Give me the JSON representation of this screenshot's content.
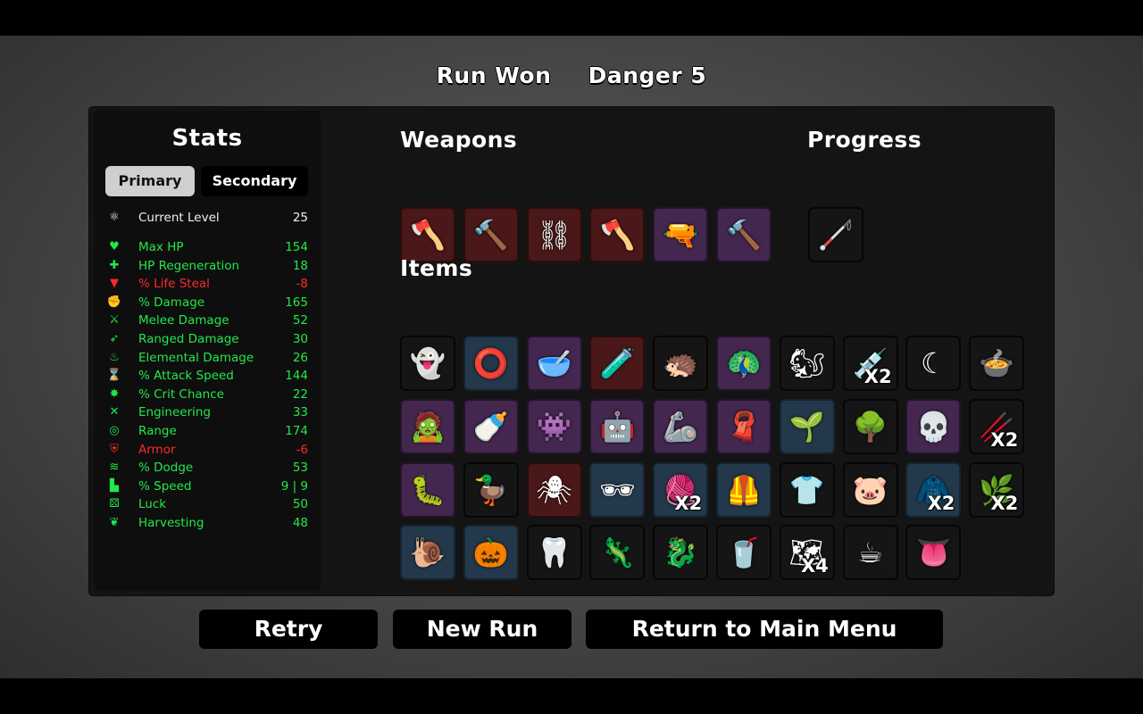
{
  "header": {
    "result": "Run Won",
    "danger": "Danger 5"
  },
  "stats": {
    "title": "Stats",
    "tabs": {
      "primary": "Primary",
      "secondary": "Secondary"
    },
    "level": {
      "label": "Current Level",
      "value": "25",
      "icon": "level-icon"
    },
    "rows": [
      {
        "label": "Max HP",
        "value": "154",
        "color": "#22e84a",
        "icon": "heart-icon"
      },
      {
        "label": "HP Regeneration",
        "value": "18",
        "color": "#22e84a",
        "icon": "heart-plus-icon"
      },
      {
        "label": "% Life Steal",
        "value": "-8",
        "color": "#ff2a2a",
        "icon": "fangs-icon"
      },
      {
        "label": "% Damage",
        "value": "165",
        "color": "#22e84a",
        "icon": "fist-icon"
      },
      {
        "label": "Melee Damage",
        "value": "52",
        "color": "#22e84a",
        "icon": "sword-icon"
      },
      {
        "label": "Ranged Damage",
        "value": "30",
        "color": "#22e84a",
        "icon": "bow-icon"
      },
      {
        "label": "Elemental Damage",
        "value": "26",
        "color": "#22e84a",
        "icon": "flame-icon"
      },
      {
        "label": "% Attack Speed",
        "value": "144",
        "color": "#22e84a",
        "icon": "hourglass-icon"
      },
      {
        "label": "% Crit Chance",
        "value": "22",
        "color": "#22e84a",
        "icon": "crit-icon"
      },
      {
        "label": "Engineering",
        "value": "33",
        "color": "#22e84a",
        "icon": "wrench-icon"
      },
      {
        "label": "Range",
        "value": "174",
        "color": "#22e84a",
        "icon": "range-icon"
      },
      {
        "label": "Armor",
        "value": "-6",
        "color": "#ff2a2a",
        "icon": "shield-icon"
      },
      {
        "label": "% Dodge",
        "value": "53",
        "color": "#22e84a",
        "icon": "dodge-icon"
      },
      {
        "label": "% Speed",
        "value": "9 | 9",
        "color": "#22e84a",
        "icon": "boot-icon"
      },
      {
        "label": "Luck",
        "value": "50",
        "color": "#22e84a",
        "icon": "dice-icon"
      },
      {
        "label": "Harvesting",
        "value": "48",
        "color": "#22e84a",
        "icon": "wheat-icon"
      }
    ]
  },
  "weapons": {
    "title": "Weapons",
    "slots": [
      {
        "icon": "axe-icon",
        "tier": "red"
      },
      {
        "icon": "skull-hammer-icon",
        "tier": "red"
      },
      {
        "icon": "chain-whip-icon",
        "tier": "red"
      },
      {
        "icon": "axe-icon",
        "tier": "red"
      },
      {
        "icon": "blaster-icon",
        "tier": "purple"
      },
      {
        "icon": "skull-hammer-icon",
        "tier": "purple"
      }
    ]
  },
  "progress": {
    "title": "Progress",
    "slots": [
      {
        "icon": "stick-icon",
        "tier": "black"
      }
    ]
  },
  "items": {
    "title": "Items",
    "slots": [
      {
        "icon": "ghost-icon",
        "tier": "black",
        "qty": ""
      },
      {
        "icon": "ring-icon",
        "tier": "blue",
        "qty": ""
      },
      {
        "icon": "mortar-icon",
        "tier": "purple",
        "qty": ""
      },
      {
        "icon": "test-tube-icon",
        "tier": "red",
        "qty": ""
      },
      {
        "icon": "hedgehog-icon",
        "tier": "black",
        "qty": ""
      },
      {
        "icon": "peacock-icon",
        "tier": "purple",
        "qty": ""
      },
      {
        "icon": "creature-icon",
        "tier": "black",
        "qty": ""
      },
      {
        "icon": "syringe-icon",
        "tier": "black",
        "qty": "X2"
      },
      {
        "icon": "sickle-icon",
        "tier": "black",
        "qty": ""
      },
      {
        "icon": "cauldron-icon",
        "tier": "black",
        "qty": ""
      },
      {
        "icon": "zombie-icon",
        "tier": "purple",
        "qty": ""
      },
      {
        "icon": "bottle-icon",
        "tier": "purple",
        "qty": ""
      },
      {
        "icon": "alien-icon",
        "tier": "purple",
        "qty": ""
      },
      {
        "icon": "robot-icon",
        "tier": "purple",
        "qty": ""
      },
      {
        "icon": "arm-icon",
        "tier": "purple",
        "qty": ""
      },
      {
        "icon": "bandana-icon",
        "tier": "purple",
        "qty": ""
      },
      {
        "icon": "garden-icon",
        "tier": "blue",
        "qty": ""
      },
      {
        "icon": "tree-icon",
        "tier": "black",
        "qty": ""
      },
      {
        "icon": "skull-pile-icon",
        "tier": "purple",
        "qty": ""
      },
      {
        "icon": "red-twig-icon",
        "tier": "black",
        "qty": "X2"
      },
      {
        "icon": "tardigrade-icon",
        "tier": "purple",
        "qty": ""
      },
      {
        "icon": "duck-icon",
        "tier": "black",
        "qty": ""
      },
      {
        "icon": "spider-icon",
        "tier": "red",
        "qty": ""
      },
      {
        "icon": "glasses-icon",
        "tier": "blue",
        "qty": ""
      },
      {
        "icon": "scarf-icon",
        "tier": "blue",
        "qty": "X2"
      },
      {
        "icon": "leather-vest-icon",
        "tier": "blue",
        "qty": ""
      },
      {
        "icon": "flannel-shirt-icon",
        "tier": "black",
        "qty": ""
      },
      {
        "icon": "piggy-bank-icon",
        "tier": "black",
        "qty": ""
      },
      {
        "icon": "cape-icon",
        "tier": "blue",
        "qty": "X2"
      },
      {
        "icon": "sprout-icon",
        "tier": "black",
        "qty": "X2"
      },
      {
        "icon": "snail-icon",
        "tier": "blue",
        "qty": ""
      },
      {
        "icon": "pumpkin-icon",
        "tier": "blue",
        "qty": ""
      },
      {
        "icon": "tooth-icon",
        "tier": "black",
        "qty": ""
      },
      {
        "icon": "lizard-icon",
        "tier": "black",
        "qty": ""
      },
      {
        "icon": "seahorse-icon",
        "tier": "black",
        "qty": ""
      },
      {
        "icon": "lemonade-icon",
        "tier": "black",
        "qty": ""
      },
      {
        "icon": "treasure-map-icon",
        "tier": "black",
        "qty": "X4"
      },
      {
        "icon": "coffee-cup-icon",
        "tier": "black",
        "qty": ""
      },
      {
        "icon": "tongue-icon",
        "tier": "black",
        "qty": ""
      }
    ]
  },
  "buttons": {
    "retry": "Retry",
    "new_run": "New Run",
    "main_menu": "Return to Main Menu"
  }
}
